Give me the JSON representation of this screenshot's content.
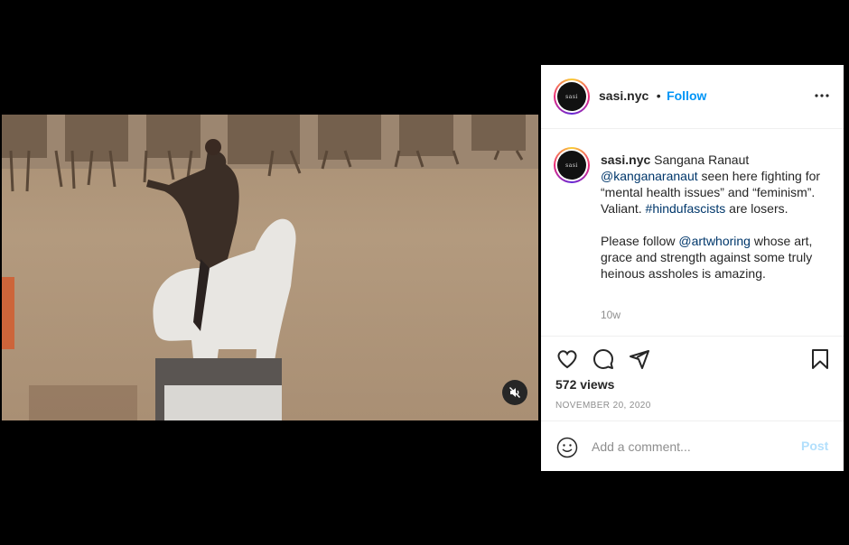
{
  "video": {
    "mute_icon": "speaker-muted-icon"
  },
  "post": {
    "username": "sasi.nyc",
    "avatar_text": "sasi",
    "follow_label": "Follow",
    "separator": "•",
    "caption": {
      "username": "sasi.nyc",
      "line1_a": " Sangana Ranaut ",
      "mention1": "@kanganaranaut",
      "line1_b": " seen here fighting for “mental health issues” and “feminism”. Valiant. ",
      "hashtag": "#hindufascists",
      "line1_c": " are losers.",
      "line2_a": "Please follow ",
      "mention2": "@artwhoring",
      "line2_b": " whose art, grace and strength against some truly heinous assholes is amazing."
    },
    "time_ago": "10w",
    "views": "572 views",
    "date": "NOVEMBER 20, 2020",
    "comment_placeholder": "Add a comment...",
    "post_label": "Post",
    "colors": {
      "accent": "#0095f6",
      "link": "#00376b",
      "post_disabled": "#b2dffc"
    }
  }
}
